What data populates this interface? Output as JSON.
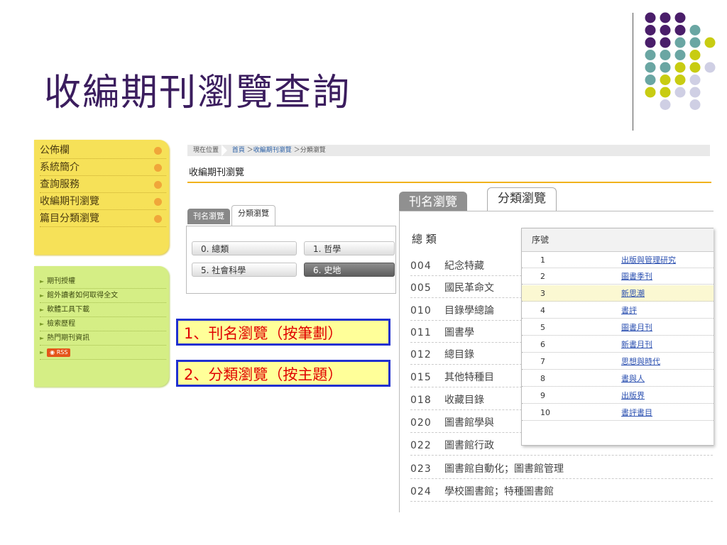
{
  "slide": {
    "title": "收編期刊瀏覽查詢"
  },
  "colors": {
    "title": "#3b1d5e",
    "purple": "#4a1e6a",
    "teal": "#6aa6a3",
    "yellow_green": "#c8cc12",
    "lavender": "#cfcfe4",
    "menu_yellow": "#f6e158",
    "menu_green": "#d5ee85",
    "accent_orange": "#f0b21c",
    "callout_border": "#2030d0",
    "callout_text": "#e00000"
  },
  "sidebar": {
    "main_menu": [
      {
        "label": "公佈欄"
      },
      {
        "label": "系統簡介"
      },
      {
        "label": "查詢服務"
      },
      {
        "label": "收編期刊瀏覽"
      },
      {
        "label": "篇目分類瀏覽"
      }
    ],
    "sub_menu": [
      {
        "label": "期刊授權"
      },
      {
        "label": "館外讀者如何取得全文"
      },
      {
        "label": "軟體工具下載"
      },
      {
        "label": "檢索歷程"
      },
      {
        "label": "熱門期刊資訊"
      }
    ],
    "rss_label": "RSS"
  },
  "breadcrumb": {
    "label": "現在位置",
    "home": "首頁",
    "level1": "收編期刊瀏覽",
    "level2": "分類瀏覽"
  },
  "section_title": "收編期刊瀏覽",
  "small_tabs": {
    "tab1": "刊名瀏覽",
    "tab2": "分類瀏覽",
    "categories": [
      {
        "label": "0. 總類"
      },
      {
        "label": "1. 哲學"
      },
      {
        "label": "5. 社會科學"
      },
      {
        "label": "6. 史地"
      }
    ]
  },
  "callouts": {
    "first": "1、刊名瀏覽（按筆劃）",
    "second": "2、分類瀏覽（按主題）"
  },
  "big_tabs": {
    "tab1": "刊名瀏覽",
    "tab2": "分類瀏覽"
  },
  "category_list": {
    "heading": "總 類",
    "rows": [
      {
        "code": "004",
        "name": "紀念特藏"
      },
      {
        "code": "005",
        "name": "國民革命文"
      },
      {
        "code": "010",
        "name": "目錄學總論"
      },
      {
        "code": "011",
        "name": "圖書學"
      },
      {
        "code": "012",
        "name": "總目錄"
      },
      {
        "code": "015",
        "name": "其他特種目"
      },
      {
        "code": "018",
        "name": "收藏目錄"
      },
      {
        "code": "020",
        "name": "圖書館學與"
      },
      {
        "code": "022",
        "name": "圖書館行政"
      },
      {
        "code": "023",
        "name": "圖書館自動化；圖書館管理"
      },
      {
        "code": "024",
        "name": "學校圖書館；特種圖書館"
      }
    ]
  },
  "journal_list": {
    "header": "序號",
    "rows": [
      {
        "num": "1",
        "title": "出版與管理研究"
      },
      {
        "num": "2",
        "title": "圖書季刊"
      },
      {
        "num": "3",
        "title": "新思潮"
      },
      {
        "num": "4",
        "title": "書評"
      },
      {
        "num": "5",
        "title": "圖書月刊"
      },
      {
        "num": "6",
        "title": "新書月刊"
      },
      {
        "num": "7",
        "title": "思想與時代"
      },
      {
        "num": "8",
        "title": "書與人"
      },
      {
        "num": "9",
        "title": "出版界"
      },
      {
        "num": "10",
        "title": "書評書目"
      }
    ]
  }
}
